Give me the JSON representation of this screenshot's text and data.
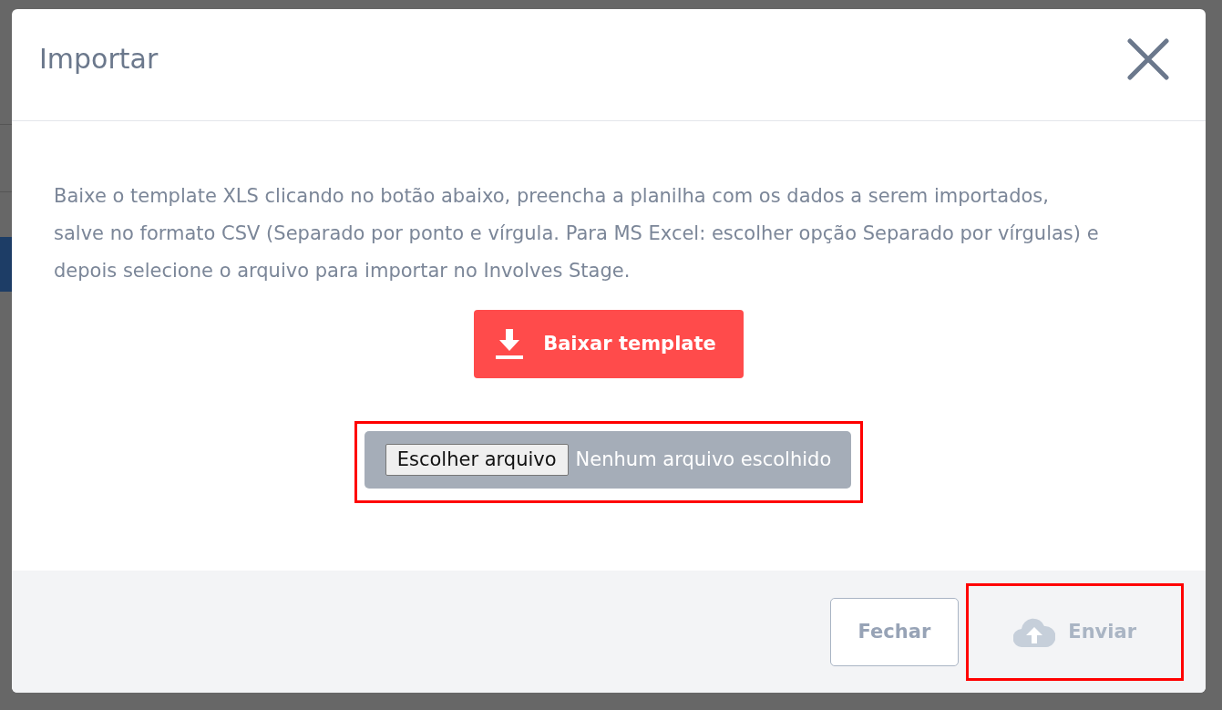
{
  "modal": {
    "title": "Importar",
    "instructions": "Baixe o template XLS clicando no botão abaixo, preencha a planilha com os dados a serem importados, salve no formato CSV (Separado por ponto e vírgula. Para MS Excel: escolher opção Separado por vírgulas) e depois selecione o arquivo para importar no Involves Stage.",
    "download_button": {
      "label": "Baixar template"
    },
    "file_input": {
      "button": "Escolher arquivo",
      "status": "Nenhum arquivo escolhido",
      "highlighted": true
    },
    "footer_buttons": [
      {
        "label": "Fechar",
        "kind": "outline",
        "disabled": false,
        "highlighted": false
      },
      {
        "label": "Enviar",
        "kind": "upload",
        "disabled": true,
        "highlighted": true
      }
    ]
  }
}
